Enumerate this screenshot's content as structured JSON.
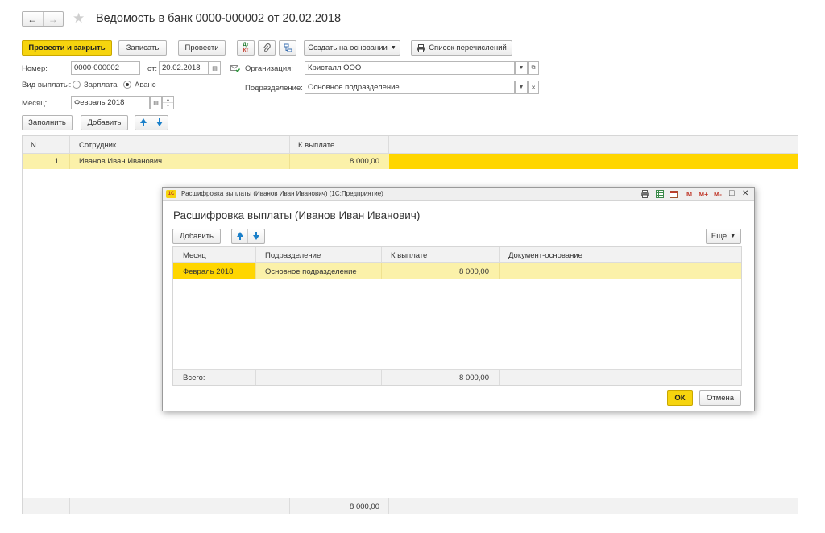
{
  "header": {
    "title": "Ведомость в банк 0000-000002 от 20.02.2018",
    "back_glyph": "←",
    "forward_glyph": "→",
    "star_glyph": "★"
  },
  "toolbar": {
    "post_close": "Провести и закрыть",
    "save": "Записать",
    "post": "Провести",
    "dtkt_top": "Дт",
    "dtkt_bottom": "Кт",
    "create_based": "Создать на основании",
    "transfer_list": "Список перечислений"
  },
  "form": {
    "number_label": "Номер:",
    "number_value": "0000-000002",
    "date_label": "от:",
    "date_value": "20.02.2018",
    "org_label": "Организация:",
    "org_value": "Кристалл ООО",
    "pay_type_label": "Вид выплаты:",
    "pay_option_salary": "Зарплата",
    "pay_option_advance": "Аванс",
    "division_label": "Подразделение:",
    "division_value": "Основное подразделение",
    "month_label": "Месяц:",
    "month_value": "Февраль 2018"
  },
  "table_toolbar": {
    "fill": "Заполнить",
    "add": "Добавить"
  },
  "main_table": {
    "headers": [
      "N",
      "Сотрудник",
      "К выплате"
    ],
    "rows": [
      {
        "n": "1",
        "employee": "Иванов Иван Иванович",
        "amount": "8 000,00"
      }
    ],
    "total": "8 000,00"
  },
  "dialog": {
    "window_title": "Расшифровка выплаты (Иванов Иван Иванович) (1С:Предприятие)",
    "logo": "1С",
    "heading": "Расшифровка выплаты (Иванов Иван Иванович)",
    "add": "Добавить",
    "more": "Еще",
    "headers": [
      "Месяц",
      "Подразделение",
      "К выплате",
      "Документ-основание"
    ],
    "rows": [
      {
        "month": "Февраль 2018",
        "division": "Основное подразделение",
        "amount": "8 000,00",
        "doc": ""
      }
    ],
    "footer_label": "Всего:",
    "footer_total": "8 000,00",
    "ok": "ОК",
    "cancel": "Отмена",
    "title_icons": {
      "m": "M",
      "mplus": "M+",
      "mminus": "M-",
      "restore": "□",
      "close": "✕"
    }
  },
  "colors": {
    "accent_yellow": "#f6d40e",
    "row_highlight": "#fbf1a9",
    "row_selected": "#ffd600"
  }
}
